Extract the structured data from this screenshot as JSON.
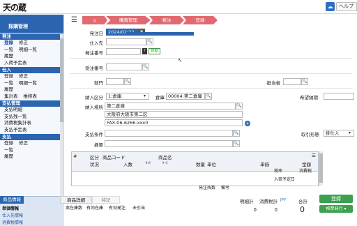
{
  "app": {
    "logo": "天の蔵",
    "help_label": "ヘルプ"
  },
  "sidebar": {
    "title": "採購管理",
    "sections": [
      {
        "title": "発注",
        "rows": [
          [
            "登録",
            "修正"
          ],
          [
            "一覧",
            "明細一覧"
          ],
          [
            "履歴"
          ],
          [
            "入荷予定表"
          ]
        ]
      },
      {
        "title": "仕入",
        "rows": [
          [
            "登録",
            "修正"
          ],
          [
            "一覧",
            "明細一覧"
          ],
          [
            "履歴"
          ],
          [
            "集計表",
            "推移表"
          ]
        ]
      },
      {
        "title": "支払管理",
        "rows": [
          [
            "支払明細"
          ],
          [
            "支払残一覧"
          ],
          [
            "消費税集計表"
          ],
          [
            "支払予定表"
          ]
        ]
      },
      {
        "title": "支払",
        "rows": [
          [
            "登録",
            "修正"
          ],
          [
            "一覧"
          ],
          [
            "履歴"
          ]
        ]
      }
    ]
  },
  "breadcrumb": [
    "購買管理",
    "発注",
    "登録"
  ],
  "form": {
    "order_date_label": "発注日",
    "order_date": "2024/02/22",
    "supplier_label": "仕入先",
    "supplier": "",
    "order_no_label": "発注番号",
    "order_no": "",
    "order_no_badge": "自動",
    "deal_no_label": "受注番号",
    "deal_no": "",
    "dept_label": "部門",
    "dept": "",
    "staff_label": "担当者",
    "staff": "",
    "stock_class_label": "納入区分",
    "stock_class": "1:倉庫",
    "warehouse_label": "倉庫",
    "warehouse": "00004:第二倉庫",
    "hope_date_label": "希望納期",
    "hope_date": "",
    "delivery_label": "納入場所",
    "delivery_name": "第二倉庫",
    "delivery_address": "大阪府大阪市第二区",
    "delivery_fax": "FAX:06-6266-xxx0",
    "pay_terms_label": "支払条件",
    "pay_terms": "",
    "remarks_label": "摘要",
    "remarks": "",
    "trade_type_label": "取引形態",
    "trade_type": "掛仕入"
  },
  "grid": {
    "row1": [
      "#",
      "区分",
      "商品コード",
      "商品名"
    ],
    "row2": [
      "状況",
      "入数",
      "ｾｯﾄ",
      "ｹｰｽ",
      "数量",
      "単位",
      "単価",
      "金額"
    ],
    "row3": [
      "税率",
      "消費税"
    ],
    "row4": [
      "入荷予定日"
    ],
    "row5": [
      "発注残数",
      "備考"
    ]
  },
  "bottom_tabs": [
    "商品情報",
    "商品詳細",
    "特記"
  ],
  "bottom_cols": [
    "実在庫数",
    "有効在庫",
    "有効発注",
    "未引当"
  ],
  "bottom_side": [
    "単価情報",
    "仕入先情報",
    "消費税情報"
  ],
  "totals": {
    "labels": [
      "明細計",
      "消費税計",
      "JPY",
      "合計"
    ],
    "values": [
      "0",
      "0",
      "0"
    ]
  },
  "buttons": {
    "register": "登録",
    "form_issue": "帳票発行 ▾"
  }
}
